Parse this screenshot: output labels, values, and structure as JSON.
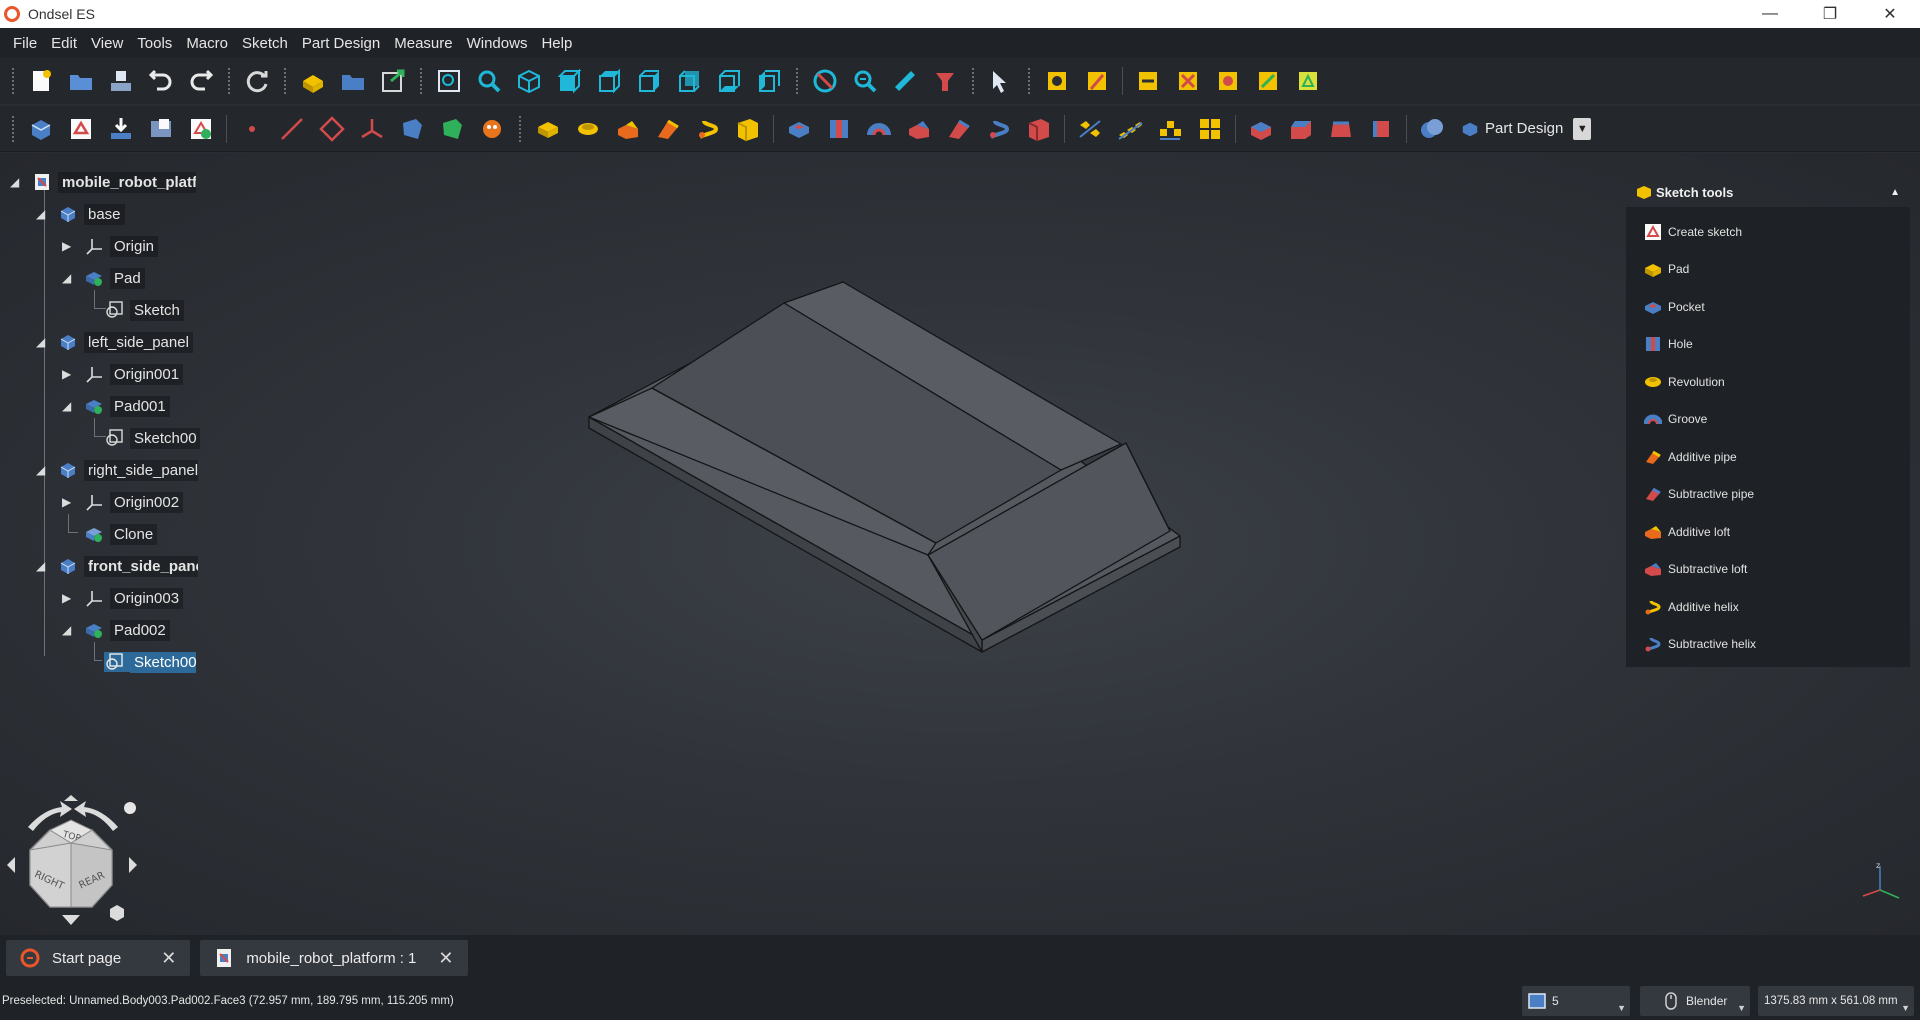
{
  "window": {
    "title": "Ondsel ES",
    "minimize": "—",
    "restore": "❐",
    "close": "✕"
  },
  "menu": [
    "File",
    "Edit",
    "View",
    "Tools",
    "Macro",
    "Sketch",
    "Part Design",
    "Measure",
    "Windows",
    "Help"
  ],
  "workbench": {
    "label": "Part Design",
    "arrow": "▼"
  },
  "tree": {
    "root": "mobile_robot_platf",
    "items": [
      {
        "label": "base"
      },
      {
        "label": "Origin"
      },
      {
        "label": "Pad"
      },
      {
        "label": "Sketch"
      },
      {
        "label": "left_side_panel"
      },
      {
        "label": "Origin001"
      },
      {
        "label": "Pad001"
      },
      {
        "label": "Sketch00"
      },
      {
        "label": "right_side_panel"
      },
      {
        "label": "Origin002"
      },
      {
        "label": "Clone"
      },
      {
        "label": "front_side_pane"
      },
      {
        "label": "Origin003"
      },
      {
        "label": "Pad002"
      },
      {
        "label": "Sketch00"
      }
    ]
  },
  "task_panel": {
    "title": "Sketch tools",
    "caret": "▲",
    "items": [
      "Create sketch",
      "Pad",
      "Pocket",
      "Hole",
      "Revolution",
      "Groove",
      "Additive pipe",
      "Subtractive pipe",
      "Additive loft",
      "Subtractive loft",
      "Additive helix",
      "Subtractive helix"
    ]
  },
  "navcube": {
    "top": "TOP",
    "right": "RIGHT",
    "rear": "REAR"
  },
  "axis": {
    "z": "z"
  },
  "tabs": [
    {
      "label": "Start page",
      "close": "✕"
    },
    {
      "label": "mobile_robot_platform : 1",
      "close": "✕"
    }
  ],
  "status": {
    "message": "Preselected: Unnamed.Body003.Pad002.Face3 (72.957 mm, 189.795 mm, 115.205 mm)",
    "draw_style": "5",
    "navigation": "Blender",
    "dimensions": "1375.83 mm x 561.08 mm"
  },
  "colors": {
    "accent": "#2d6a99",
    "toolbar_cyan": "#1fb8d8",
    "brand": "#e8562a"
  }
}
